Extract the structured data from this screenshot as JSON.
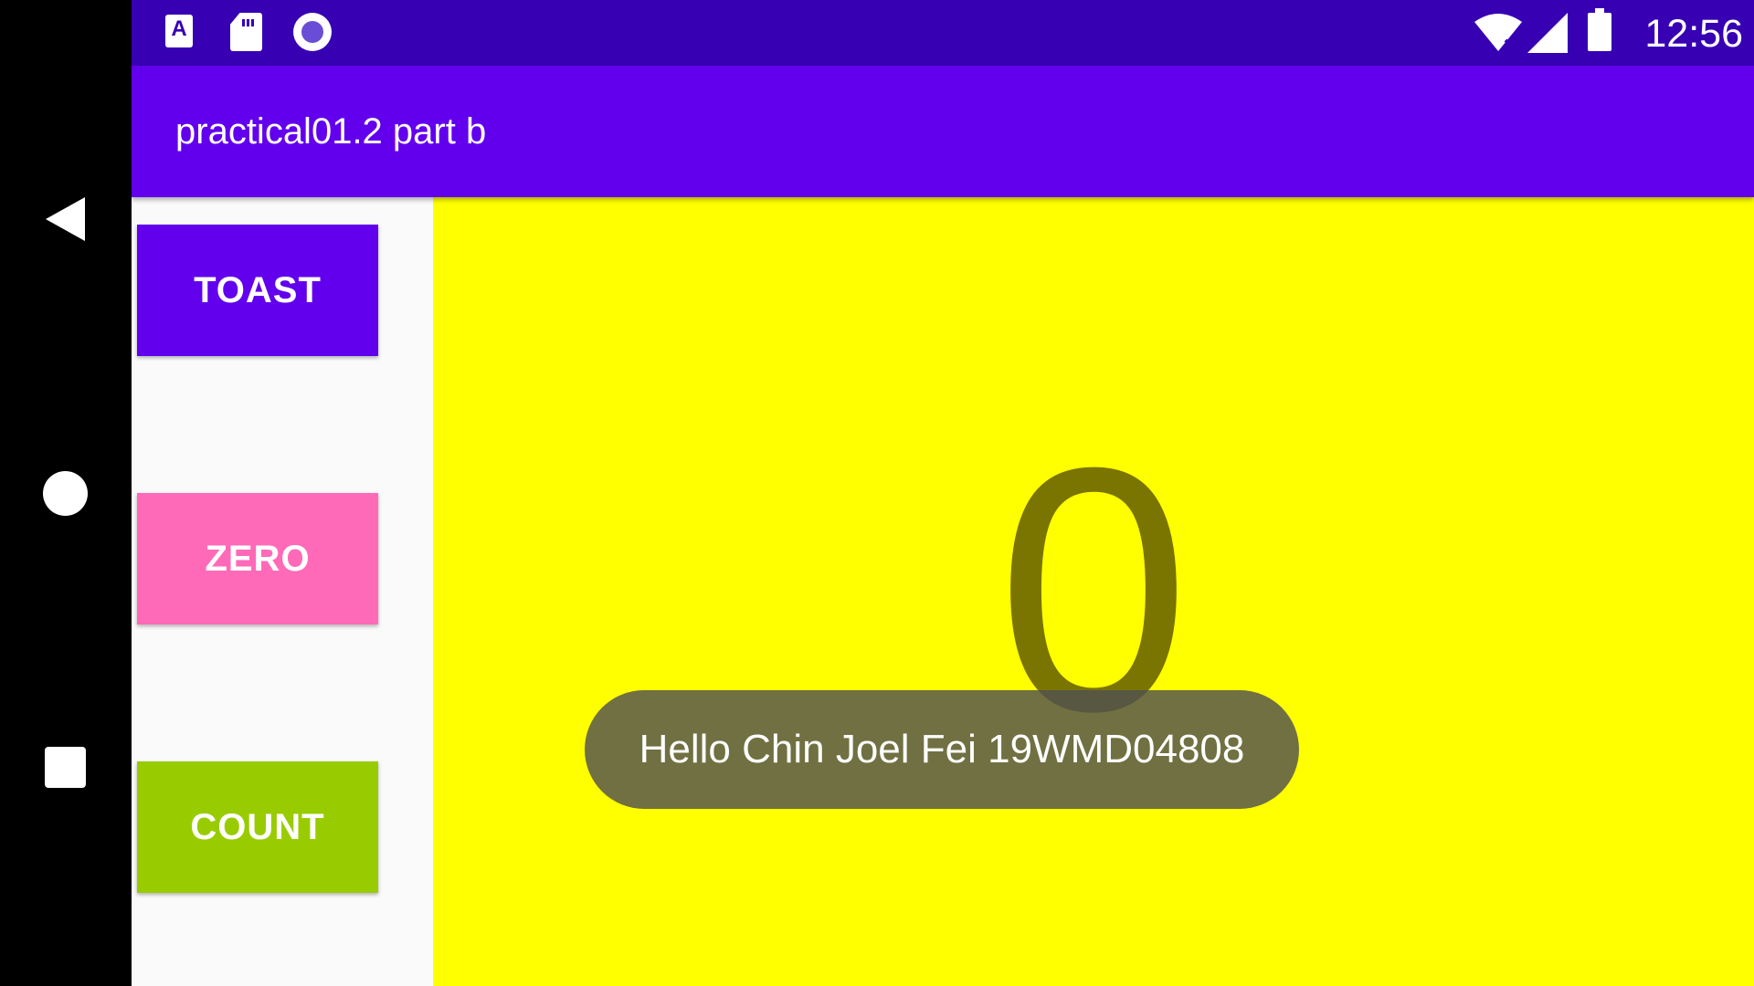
{
  "status_bar": {
    "time": "12:56",
    "icons": [
      "app-a-icon",
      "sd-card-icon",
      "circle-status-icon",
      "wifi-off-icon",
      "signal-icon",
      "battery-icon"
    ]
  },
  "app_bar": {
    "title": "practical01.2 part b"
  },
  "buttons": {
    "toast": "TOAST",
    "zero": "ZERO",
    "count": "COUNT"
  },
  "counter": {
    "value": "0"
  },
  "toast_message": "Hello Chin Joel Fei 19WMD04808",
  "nav_bar": {
    "icons": [
      "back-icon",
      "home-icon",
      "recents-icon"
    ]
  },
  "colors": {
    "status_bar": "#3700b3",
    "app_bar": "#6200ee",
    "toast_button": "#6200ee",
    "zero_button": "#ff6ab8",
    "count_button": "#99cc00",
    "count_panel": "#ffff00",
    "count_text": "#7a7500"
  }
}
